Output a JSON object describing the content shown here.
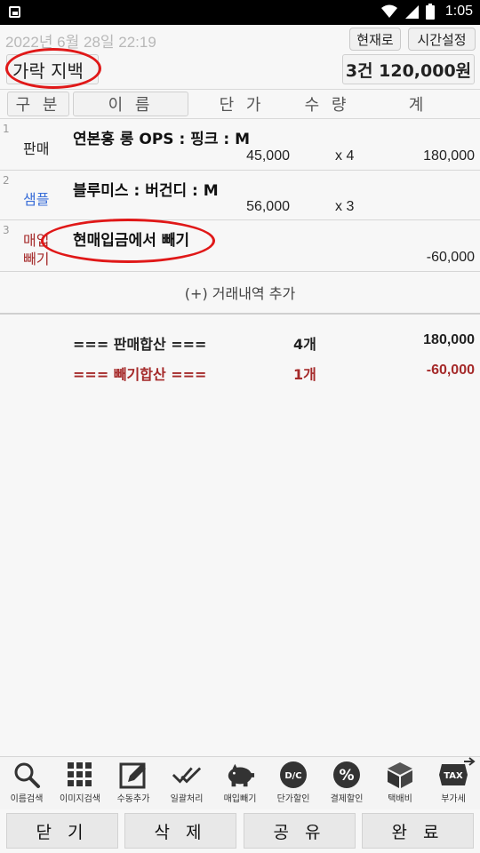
{
  "status_bar": {
    "time": "1:05"
  },
  "header": {
    "datetime": "2022년 6월 28일 22:19",
    "now_button": "현재로",
    "time_setting_button": "시간설정",
    "customer_name": "가락 지백",
    "summary_total": "3건 120,000원"
  },
  "columns": {
    "type": "구 분",
    "name": "이 름",
    "unit_price": "단 가",
    "quantity": "수 량",
    "total": "계"
  },
  "items": [
    {
      "num": "1",
      "type": "판매",
      "name": "연본홍  롱 OPS : 핑크 : M",
      "price": "45,000",
      "qty": "x 4",
      "amount": "180,000"
    },
    {
      "num": "2",
      "type": "샘플",
      "name": "블루미스 : 버건디 : M",
      "price": "56,000",
      "qty": "x 3",
      "amount": ""
    },
    {
      "num": "3",
      "type_line1": "매입",
      "type_line2": "빼기",
      "name": "현매입금에서 빼기",
      "amount": "-60,000"
    }
  ],
  "add_transaction": "(+) 거래내역 추가",
  "sums": {
    "sales_label": "=== 판매합산 ===",
    "sales_count": "4개",
    "sales_total": "180,000",
    "deduct_label": "=== 빼기합산 ===",
    "deduct_count": "1개",
    "deduct_total": "-60,000"
  },
  "toolbar": [
    {
      "label": "이름검색",
      "icon": "search-icon"
    },
    {
      "label": "이미지검색",
      "icon": "grid-icon"
    },
    {
      "label": "수동추가",
      "icon": "edit-icon"
    },
    {
      "label": "일괄처리",
      "icon": "double-check-icon"
    },
    {
      "label": "매입빼기",
      "icon": "piggy-bank-icon"
    },
    {
      "label": "단가할인",
      "icon": "dc-badge-icon",
      "badge": "D/C"
    },
    {
      "label": "결제할인",
      "icon": "percent-badge-icon",
      "badge": "%"
    },
    {
      "label": "택배비",
      "icon": "box-icon"
    },
    {
      "label": "부가세",
      "icon": "tax-icon",
      "badge": "TAX"
    }
  ],
  "bottom_buttons": {
    "close": "닫 기",
    "delete": "삭 제",
    "share": "공 유",
    "done": "완 료"
  },
  "colors": {
    "sample_blue": "#3b6fd8",
    "deduct_red": "#a52a2a",
    "annotation_red": "#e01818"
  }
}
